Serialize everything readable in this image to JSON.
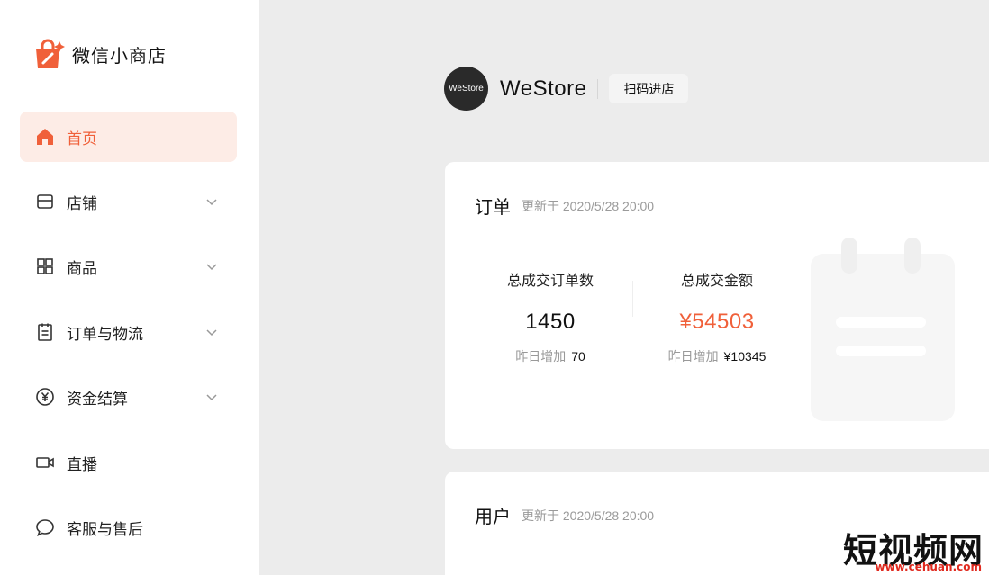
{
  "app": {
    "title": "微信小商店"
  },
  "colors": {
    "accent": "#f0603a",
    "active_bg": "#fdece6"
  },
  "sidebar": {
    "items": [
      {
        "label": "首页",
        "icon": "home-icon",
        "active": true,
        "expandable": false
      },
      {
        "label": "店铺",
        "icon": "store-icon",
        "active": false,
        "expandable": true
      },
      {
        "label": "商品",
        "icon": "grid-icon",
        "active": false,
        "expandable": true
      },
      {
        "label": "订单与物流",
        "icon": "clipboard-icon",
        "active": false,
        "expandable": true
      },
      {
        "label": "资金结算",
        "icon": "yuan-icon",
        "active": false,
        "expandable": true
      },
      {
        "label": "直播",
        "icon": "video-icon",
        "active": false,
        "expandable": false
      },
      {
        "label": "客服与售后",
        "icon": "chat-icon",
        "active": false,
        "expandable": false
      }
    ]
  },
  "store": {
    "name": "WeStore",
    "avatar_text": "WeStore",
    "scan_button": "扫码进店"
  },
  "orders_card": {
    "title": "订单",
    "updated": "更新于 2020/5/28 20:00",
    "stats": [
      {
        "label": "总成交订单数",
        "value": "1450",
        "sub_label": "昨日增加",
        "sub_value": "70"
      },
      {
        "label": "总成交金额",
        "value": "¥54503",
        "sub_label": "昨日增加",
        "sub_value": "¥10345"
      }
    ]
  },
  "users_card": {
    "title": "用户",
    "updated": "更新于 2020/5/28 20:00"
  },
  "watermark": {
    "text": "短视频网",
    "url": "www.cehuan.com"
  }
}
